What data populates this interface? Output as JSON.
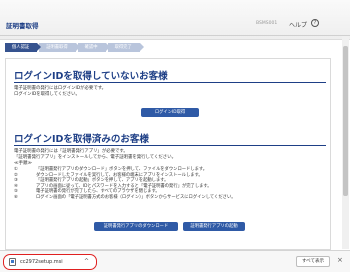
{
  "header": {
    "title": "証明書取得",
    "code": "BSMS001",
    "help_label": "ヘルプ",
    "help_icon": "?"
  },
  "steps": [
    {
      "label": "個人認証",
      "active": true
    },
    {
      "label": "証明書取得",
      "active": false
    },
    {
      "label": "確認中",
      "active": false
    },
    {
      "label": "取得完了",
      "active": false
    }
  ],
  "section_no_id": {
    "title": "ログインIDを取得していないお客様",
    "text_lines": [
      "電子証明書の発行にはログインIDが必要です。",
      "ログインIDを取得してください。"
    ],
    "button_label": "ログインID取得"
  },
  "section_has_id": {
    "title": "ログインIDを取得済みのお客様",
    "intro_lines": [
      "電子証明書の発行には「証明書発行アプリ」が必要です。",
      "「証明書発行アプリ」をインストールしてから、電子証明書を発行してください。",
      "≪手順≫"
    ],
    "steps": [
      {
        "num": "①",
        "text": "「証明書発行アプリのダウンロード」ボタンを押して、ファイルをダウンロードします。"
      },
      {
        "num": "②",
        "text": "ダウンロードしたファイルを実行して、お客様の端末にアプリをインストールします。"
      },
      {
        "num": "③",
        "text": "「証明書発行アプリの起動」ボタンを押して、アプリを起動します。"
      },
      {
        "num": "④",
        "text": "アプリの画面に従って、IDとパスワードを入力すると「電子証明書の発行」が完了します。"
      },
      {
        "num": "⑤",
        "text": "電子証明書の発行が完了したら、すべてのブラウザを閉じます。"
      },
      {
        "num": "⑥",
        "text": "ログイン画面の「電子証明書方式のお客様（ログイン）」ボタンからサービスにログインしてください。"
      }
    ],
    "download_button_label": "証明書発行アプリのダウンロード",
    "launch_button_label": "証明書発行アプリの起動"
  },
  "download_bar": {
    "file_name": "cc2972setup.msi",
    "chevron": "^",
    "show_all_label": "すべて表示",
    "close_symbol": "×"
  }
}
